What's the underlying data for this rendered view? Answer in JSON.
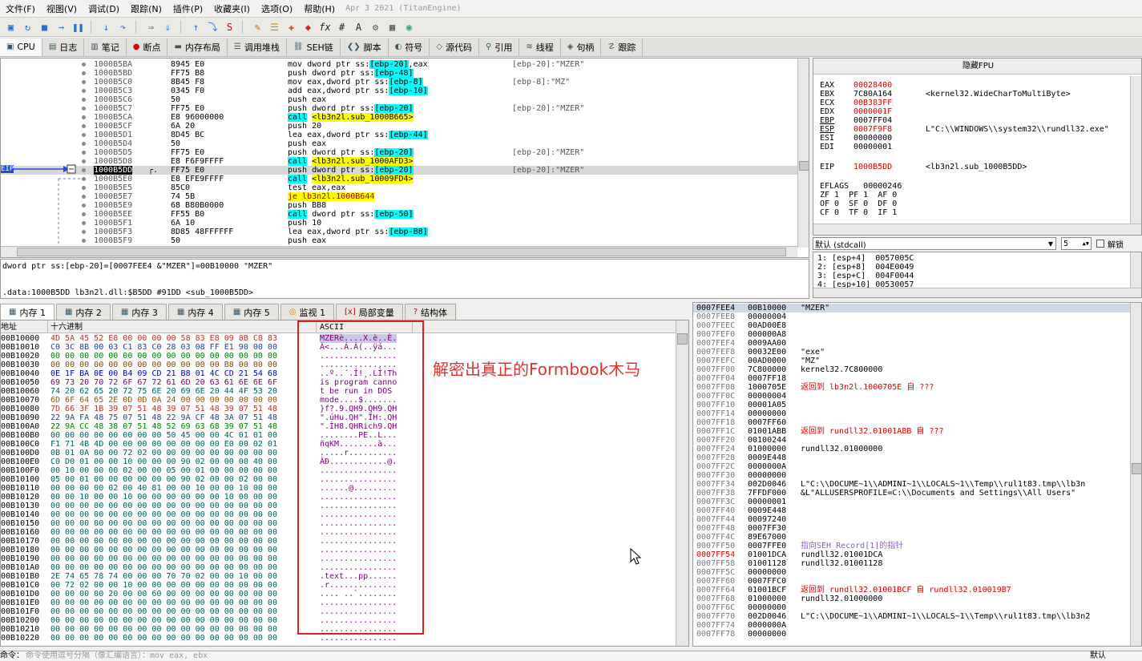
{
  "menu": [
    "文件(F)",
    "视图(V)",
    "调试(D)",
    "跟踪(N)",
    "插件(P)",
    "收藏夹(I)",
    "选项(O)",
    "帮助(H)"
  ],
  "menu_date": "Apr 3 2021 (TitanEngine)",
  "tabs": [
    {
      "label": "CPU",
      "icon": "cpu-icon"
    },
    {
      "label": "日志",
      "icon": "log-icon"
    },
    {
      "label": "笔记",
      "icon": "notes-icon"
    },
    {
      "label": "断点",
      "icon": "breakpoint-icon"
    },
    {
      "label": "内存布局",
      "icon": "memory-map-icon"
    },
    {
      "label": "调用堆栈",
      "icon": "call-stack-icon"
    },
    {
      "label": "SEH链",
      "icon": "seh-icon"
    },
    {
      "label": "脚本",
      "icon": "script-icon"
    },
    {
      "label": "符号",
      "icon": "symbol-icon"
    },
    {
      "label": "源代码",
      "icon": "source-icon"
    },
    {
      "label": "引用",
      "icon": "references-icon"
    },
    {
      "label": "线程",
      "icon": "threads-icon"
    },
    {
      "label": "句柄",
      "icon": "handles-icon"
    },
    {
      "label": "跟踪",
      "icon": "trace-icon"
    }
  ],
  "disasm": [
    {
      "addr": "1000B5BA",
      "bytes": "8945 E0",
      "instr": "mov dword ptr ss:[ebp-20],eax",
      "comment": "[ebp-20]:\"MZER\"",
      "hl": ""
    },
    {
      "addr": "1000B5BD",
      "bytes": "FF75 B8",
      "instr": "push dword ptr ss:[ebp-48]",
      "comment": "",
      "hl": ""
    },
    {
      "addr": "1000B5C0",
      "bytes": "8B45 F8",
      "instr": "mov eax,dword ptr ss:[ebp-8]",
      "comment": "[ebp-8]:\"MZ\"",
      "hl": ""
    },
    {
      "addr": "1000B5C3",
      "bytes": "0345 F0",
      "instr": "add eax,dword ptr ss:[ebp-10]",
      "comment": "",
      "hl": ""
    },
    {
      "addr": "1000B5C6",
      "bytes": "50",
      "instr": "push eax",
      "comment": "",
      "hl": ""
    },
    {
      "addr": "1000B5C7",
      "bytes": "FF75 E0",
      "instr": "push dword ptr ss:[ebp-20]",
      "comment": "[ebp-20]:\"MZER\"",
      "hl": ""
    },
    {
      "addr": "1000B5CA",
      "bytes": "E8 96000000",
      "instr": "call <lb3n2l.sub_1000B665>",
      "comment": "",
      "hl": "call"
    },
    {
      "addr": "1000B5CF",
      "bytes": "6A 20",
      "instr": "push 20",
      "comment": "",
      "hl": ""
    },
    {
      "addr": "1000B5D1",
      "bytes": "8D45 BC",
      "instr": "lea eax,dword ptr ss:[ebp-44]",
      "comment": "",
      "hl": ""
    },
    {
      "addr": "1000B5D4",
      "bytes": "50",
      "instr": "push eax",
      "comment": "",
      "hl": ""
    },
    {
      "addr": "1000B5D5",
      "bytes": "FF75 E0",
      "instr": "push dword ptr ss:[ebp-20]",
      "comment": "[ebp-20]:\"MZER\"",
      "hl": ""
    },
    {
      "addr": "1000B5D8",
      "bytes": "E8 F6F9FFFF",
      "instr": "call <lb3n2l.sub_1000AFD3>",
      "comment": "",
      "hl": "call"
    },
    {
      "addr": "1000B5DD",
      "bytes": "FF75 E0",
      "instr": "push dword ptr ss:[ebp-20]",
      "comment": "[ebp-20]:\"MZER\"",
      "hl": "current"
    },
    {
      "addr": "1000B5E0",
      "bytes": "E8 EFE9FFFF",
      "instr": "call <lb3n2l.sub_10009FD4>",
      "comment": "",
      "hl": "call"
    },
    {
      "addr": "1000B5E5",
      "bytes": "85C0",
      "instr": "test eax,eax",
      "comment": "",
      "hl": ""
    },
    {
      "addr": "1000B5E7",
      "bytes": "74 5B",
      "instr": "je lb3n2l.1000B644",
      "comment": "",
      "hl": "jmp"
    },
    {
      "addr": "1000B5E9",
      "bytes": "68 B80B0000",
      "instr": "push BB8",
      "comment": "",
      "hl": ""
    },
    {
      "addr": "1000B5EE",
      "bytes": "FF55 B0",
      "instr": "call dword ptr ss:[ebp-50]",
      "comment": "",
      "hl": "call"
    },
    {
      "addr": "1000B5F1",
      "bytes": "6A 10",
      "instr": "push 10",
      "comment": "",
      "hl": ""
    },
    {
      "addr": "1000B5F3",
      "bytes": "8D85 48FFFFFF",
      "instr": "lea eax,dword ptr ss:[ebp-B8]",
      "comment": "",
      "hl": ""
    },
    {
      "addr": "1000B5F9",
      "bytes": "50",
      "instr": "push eax",
      "comment": "",
      "hl": ""
    }
  ],
  "eip_label": "EIP",
  "info_line1": "dword ptr ss:[ebp-20]=[0007FEE4 &\"MZER\"]=00B10000 \"MZER\"",
  "info_line2": ".data:1000B5DD lb3n2l.dll:$B5DD #91DD <sub_1000B5DD>",
  "regs_title": "隐藏FPU",
  "registers": [
    {
      "name": "EAX",
      "value": "00028400",
      "comment": "",
      "red": true
    },
    {
      "name": "EBX",
      "value": "7C80A164",
      "comment": "<kernel32.WideCharToMultiByte>",
      "red": false
    },
    {
      "name": "ECX",
      "value": "00B383FF",
      "comment": "",
      "red": true
    },
    {
      "name": "EDX",
      "value": "0000001F",
      "comment": "",
      "red": true
    },
    {
      "name": "EBP",
      "value": "0007FF04",
      "comment": "",
      "red": false
    },
    {
      "name": "ESP",
      "value": "0007F9F8",
      "comment": "L\"C:\\\\WINDOWS\\\\system32\\\\rundll32.exe\"",
      "red": true
    },
    {
      "name": "ESI",
      "value": "00000000",
      "comment": "",
      "red": false
    },
    {
      "name": "EDI",
      "value": "00000001",
      "comment": "",
      "red": false
    }
  ],
  "eip_reg": {
    "name": "EIP",
    "value": "1000B5DD",
    "comment": "<lb3n2l.sub_1000B5DD>"
  },
  "eflags": "EFLAGS   00000246",
  "flags": [
    "ZF 1  PF 1  AF 0",
    "OF 0  SF 0  DF 0",
    "CF 0  TF 0  IF 1"
  ],
  "callconv": "默认 (stdcall)",
  "callconv_count": "5",
  "unlock_label": "解锁",
  "args": [
    "1: [esp+4]  0057005C",
    "2: [esp+8]  004E0049",
    "3: [esp+C]  004F0044",
    "4: [esp+10] 00530057"
  ],
  "dump_tabs": [
    {
      "label": "内存 1",
      "icon": "dump-icon"
    },
    {
      "label": "内存 2",
      "icon": "dump-icon"
    },
    {
      "label": "内存 3",
      "icon": "dump-icon"
    },
    {
      "label": "内存 4",
      "icon": "dump-icon"
    },
    {
      "label": "内存 5",
      "icon": "dump-icon"
    },
    {
      "label": "监视 1",
      "icon": "watch-icon"
    },
    {
      "label": "局部变量",
      "icon": "locals-icon"
    },
    {
      "label": "结构体",
      "icon": "struct-icon"
    }
  ],
  "dump_header": {
    "addr": "地址",
    "hex": "十六进制",
    "ascii": "ASCII"
  },
  "dump_rows": [
    {
      "addr": "00B10000",
      "hex": "4D 5A 45 52 E8 00 00 00 00 58 83 E8 09 8B C8 83",
      "ascii": "MZERè....X.è..È."
    },
    {
      "addr": "00B10010",
      "hex": "C0 3C 8B 00 03 C1 83 C0 28 03 08 FF E1 90 00 00",
      "ascii": "À<...Á.À(..ÿá..."
    },
    {
      "addr": "00B10020",
      "hex": "00 00 00 00 00 00 00 00 00 00 00 00 00 00 00 00",
      "ascii": "................"
    },
    {
      "addr": "00B10030",
      "hex": "00 00 00 00 00 00 00 00 00 00 00 00 B8 00 00 00",
      "ascii": "............,..."
    },
    {
      "addr": "00B10040",
      "hex": "0E 1F BA 0E 00 B4 09 CD 21 B8 01 4C CD 21 54 68",
      "ascii": "..º..´.Í!¸.LÍ!Th"
    },
    {
      "addr": "00B10050",
      "hex": "69 73 20 70 72 6F 67 72 61 6D 20 63 61 6E 6E 6F",
      "ascii": "is program canno"
    },
    {
      "addr": "00B10060",
      "hex": "74 20 62 65 20 72 75 6E 20 69 6E 20 44 4F 53 20",
      "ascii": "t be run in DOS "
    },
    {
      "addr": "00B10070",
      "hex": "6D 6F 64 65 2E 0D 0D 0A 24 00 00 00 00 00 00 00",
      "ascii": "mode....$......."
    },
    {
      "addr": "00B10080",
      "hex": "7D 66 3F 1B 39 07 51 48 39 07 51 48 39 07 51 48",
      "ascii": "}f?.9.QH9.QH9.QH"
    },
    {
      "addr": "00B10090",
      "hex": "22 9A FA 48 75 07 51 48 22 9A CF 48 3A 07 51 48",
      "ascii": "\".úHu.QH\".ÏH:.QH"
    },
    {
      "addr": "00B100A0",
      "hex": "22 9A CC 48 38 07 51 48 52 69 63 68 39 07 51 48",
      "ascii": "\".ÌH8.QHRich9.QH"
    },
    {
      "addr": "00B100B0",
      "hex": "00 00 00 00 00 00 00 00 50 45 00 00 4C 01 01 00",
      "ascii": "........PE..L..."
    },
    {
      "addr": "00B100C0",
      "hex": "F1 71 4B 4D 00 00 00 00 00 00 00 00 E0 00 02 01",
      "ascii": "ñqKM........à..."
    },
    {
      "addr": "00B100D0",
      "hex": "0B 01 0A 00 00 72 02 00 00 00 00 00 00 00 00 00",
      "ascii": ".....r.........."
    },
    {
      "addr": "00B100E0",
      "hex": "C0 D0 01 00 00 10 00 00 00 90 02 00 00 00 40 00",
      "ascii": "ÀÐ............@."
    },
    {
      "addr": "00B100F0",
      "hex": "00 10 00 00 00 02 00 00 05 00 01 00 00 00 00 00",
      "ascii": "................"
    },
    {
      "addr": "00B10100",
      "hex": "05 00 01 00 00 00 00 00 00 90 02 00 00 02 00 00",
      "ascii": "................"
    },
    {
      "addr": "00B10110",
      "hex": "00 00 00 00 02 00 40 81 00 00 10 00 00 10 00 00",
      "ascii": "......@........."
    },
    {
      "addr": "00B10120",
      "hex": "00 00 10 00 00 10 00 00 00 00 00 00 10 00 00 00",
      "ascii": "................"
    },
    {
      "addr": "00B10130",
      "hex": "00 00 00 00 00 00 00 00 00 00 00 00 00 00 00 00",
      "ascii": "................"
    },
    {
      "addr": "00B10140",
      "hex": "00 00 00 00 00 00 00 00 00 00 00 00 00 00 00 00",
      "ascii": "................"
    },
    {
      "addr": "00B10150",
      "hex": "00 00 00 00 00 00 00 00 00 00 00 00 00 00 00 00",
      "ascii": "................"
    },
    {
      "addr": "00B10160",
      "hex": "00 00 00 00 00 00 00 00 00 00 00 00 00 00 00 00",
      "ascii": "................"
    },
    {
      "addr": "00B10170",
      "hex": "00 00 00 00 00 00 00 00 00 00 00 00 00 00 00 00",
      "ascii": "................"
    },
    {
      "addr": "00B10180",
      "hex": "00 00 00 00 00 00 00 00 00 00 00 00 00 00 00 00",
      "ascii": "................"
    },
    {
      "addr": "00B10190",
      "hex": "00 00 00 00 00 00 00 00 00 00 00 00 00 00 00 00",
      "ascii": "................"
    },
    {
      "addr": "00B101A0",
      "hex": "00 00 00 00 00 00 00 00 00 00 00 00 00 00 00 00",
      "ascii": "................"
    },
    {
      "addr": "00B101B0",
      "hex": "2E 74 65 78 74 00 00 00 70 70 02 00 00 10 00 00",
      "ascii": ".text...pp......"
    },
    {
      "addr": "00B101C0",
      "hex": "00 72 02 00 00 10 00 00 00 00 00 00 00 00 00 00",
      "ascii": ".r.............."
    },
    {
      "addr": "00B101D0",
      "hex": "00 00 00 00 20 00 00 60 00 00 00 00 00 00 00 00",
      "ascii": ".... ..`........"
    },
    {
      "addr": "00B101E0",
      "hex": "00 00 00 00 00 00 00 00 00 00 00 00 00 00 00 00",
      "ascii": "................"
    },
    {
      "addr": "00B101F0",
      "hex": "00 00 00 00 00 00 00 00 00 00 00 00 00 00 00 00",
      "ascii": "................"
    },
    {
      "addr": "00B10200",
      "hex": "00 00 00 00 00 00 00 00 00 00 00 00 00 00 00 00",
      "ascii": "................"
    },
    {
      "addr": "00B10210",
      "hex": "00 00 00 00 00 00 00 00 00 00 00 00 00 00 00 00",
      "ascii": "................"
    },
    {
      "addr": "00B10220",
      "hex": "00 00 00 00 00 00 00 00 00 00 00 00 00 00 00 00",
      "ascii": "................"
    }
  ],
  "annotation": "解密出真正的Formbook木马",
  "stack_rows": [
    {
      "addr": "0007FEE4",
      "value": "00B10000",
      "comment": "\"MZER\"",
      "type": "top"
    },
    {
      "addr": "0007FEE8",
      "value": "00000004",
      "comment": "",
      "type": ""
    },
    {
      "addr": "0007FEEC",
      "value": "00AD00E8",
      "comment": "",
      "type": ""
    },
    {
      "addr": "0007FEF0",
      "value": "000000A8",
      "comment": "",
      "type": ""
    },
    {
      "addr": "0007FEF4",
      "value": "0009AA00",
      "comment": "",
      "type": ""
    },
    {
      "addr": "0007FEF8",
      "value": "00032E00",
      "comment": "\"exe\"",
      "type": ""
    },
    {
      "addr": "0007FEFC",
      "value": "00AD0000",
      "comment": "\"MZ\"",
      "type": ""
    },
    {
      "addr": "0007FF00",
      "value": "7C800000",
      "comment": "kernel32.7C800000",
      "type": ""
    },
    {
      "addr": "0007FF04",
      "value": "0007FF18",
      "comment": "",
      "type": ""
    },
    {
      "addr": "0007FF08",
      "value": "1000705E",
      "comment": "返回到 lb3n2l.1000705E 自 ???",
      "type": "ret"
    },
    {
      "addr": "0007FF0C",
      "value": "00000004",
      "comment": "",
      "type": ""
    },
    {
      "addr": "0007FF10",
      "value": "00001A05",
      "comment": "",
      "type": ""
    },
    {
      "addr": "0007FF14",
      "value": "00000000",
      "comment": "",
      "type": ""
    },
    {
      "addr": "0007FF18",
      "value": "0007FF60",
      "comment": "",
      "type": ""
    },
    {
      "addr": "0007FF1C",
      "value": "01001ABB",
      "comment": "返回到 rundll32.01001ABB 自 ???",
      "type": "ret"
    },
    {
      "addr": "0007FF20",
      "value": "00100244",
      "comment": "",
      "type": ""
    },
    {
      "addr": "0007FF24",
      "value": "01000000",
      "comment": "rundll32.01000000",
      "type": ""
    },
    {
      "addr": "0007FF28",
      "value": "0009E448",
      "comment": "",
      "type": ""
    },
    {
      "addr": "0007FF2C",
      "value": "0000000A",
      "comment": "",
      "type": ""
    },
    {
      "addr": "0007FF30",
      "value": "00000000",
      "comment": "",
      "type": ""
    },
    {
      "addr": "0007FF34",
      "value": "002D0046",
      "comment": "L\"C:\\\\DOCUME~1\\\\ADMINI~1\\\\LOCALS~1\\\\Temp\\\\rul1t83.tmp\\\\lb3n",
      "type": ""
    },
    {
      "addr": "0007FF38",
      "value": "7FFDF000",
      "comment": "&L\"ALLUSERSPROFILE=C:\\\\Documents and Settings\\\\All Users\"",
      "type": ""
    },
    {
      "addr": "0007FF3C",
      "value": "00000001",
      "comment": "",
      "type": ""
    },
    {
      "addr": "0007FF40",
      "value": "0009E448",
      "comment": "",
      "type": ""
    },
    {
      "addr": "0007FF44",
      "value": "00097240",
      "comment": "",
      "type": ""
    },
    {
      "addr": "0007FF48",
      "value": "0007FF30",
      "comment": "",
      "type": ""
    },
    {
      "addr": "0007FF4C",
      "value": "89E67000",
      "comment": "",
      "type": ""
    },
    {
      "addr": "0007FF50",
      "value": "0007FFE0",
      "comment": "指向SEH_Record[1]的指针",
      "type": "seh"
    },
    {
      "addr": "0007FF54",
      "value": "01001DCA",
      "comment": "rundll32.01001DCA",
      "type": "redaddr"
    },
    {
      "addr": "0007FF58",
      "value": "01001128",
      "comment": "rundll32.01001128",
      "type": ""
    },
    {
      "addr": "0007FF5C",
      "value": "00000000",
      "comment": "",
      "type": ""
    },
    {
      "addr": "0007FF60",
      "value": "0007FFC0",
      "comment": "",
      "type": ""
    },
    {
      "addr": "0007FF64",
      "value": "01001BCF",
      "comment": "返回到 rundll32.01001BCF 自 rundll32.010019B7",
      "type": "ret"
    },
    {
      "addr": "0007FF68",
      "value": "01000000",
      "comment": "rundll32.01000000",
      "type": ""
    },
    {
      "addr": "0007FF6C",
      "value": "00000000",
      "comment": "",
      "type": ""
    },
    {
      "addr": "0007FF70",
      "value": "002D0046",
      "comment": "L\"C:\\\\DOCUME~1\\\\ADMINI~1\\\\LOCALS~1\\\\Temp\\\\rul1t83.tmp\\\\lb3n2",
      "type": ""
    },
    {
      "addr": "0007FF74",
      "value": "0000000A",
      "comment": "",
      "type": ""
    },
    {
      "addr": "0007FF78",
      "value": "00000000",
      "comment": "",
      "type": ""
    }
  ],
  "cmd_label": "命令：",
  "cmd_placeholder": "命令使用逗号分隔（像汇编语言）：mov eax, ebx",
  "status_right": "默认"
}
